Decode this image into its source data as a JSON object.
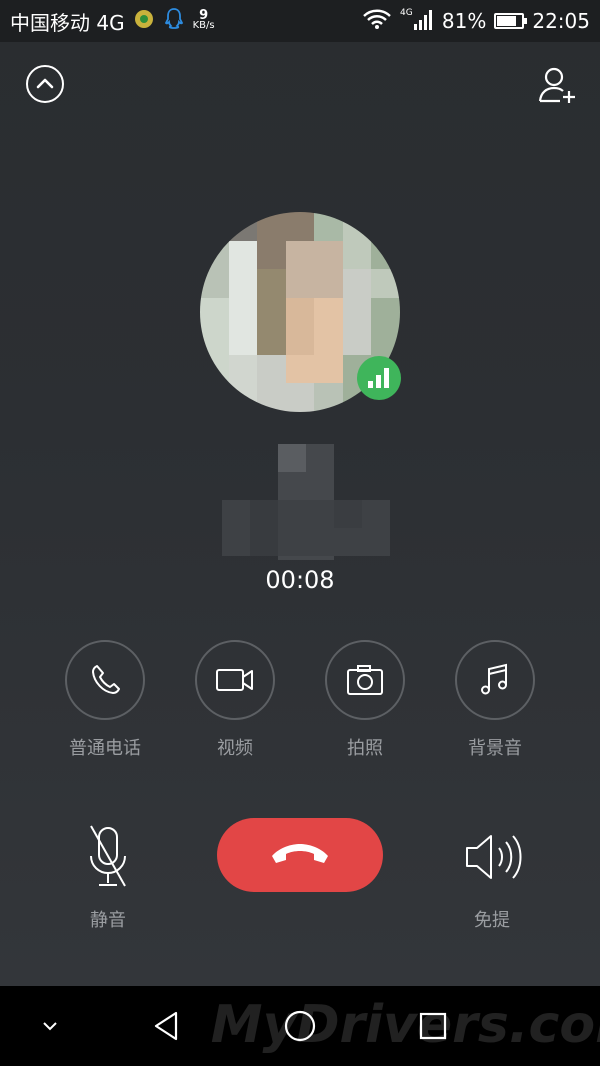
{
  "status_bar": {
    "carrier": "中国移动 4G",
    "speed_value": "9",
    "speed_unit": "KB/s",
    "network_type": "4G",
    "battery_percent": "81%",
    "battery_level": 0.81,
    "time": "22:05"
  },
  "call": {
    "timer": "00:08"
  },
  "options": [
    {
      "label": "普通电话",
      "icon": "phone-icon"
    },
    {
      "label": "视频",
      "icon": "video-icon"
    },
    {
      "label": "拍照",
      "icon": "camera-icon"
    },
    {
      "label": "背景音",
      "icon": "music-note-icon"
    }
  ],
  "controls": {
    "mute_label": "静音",
    "speaker_label": "免提"
  },
  "watermark": "MyDrivers.com",
  "colors": {
    "hangup": "#e24646",
    "signal_badge": "#3fb55b",
    "background": "#2c2f33"
  }
}
